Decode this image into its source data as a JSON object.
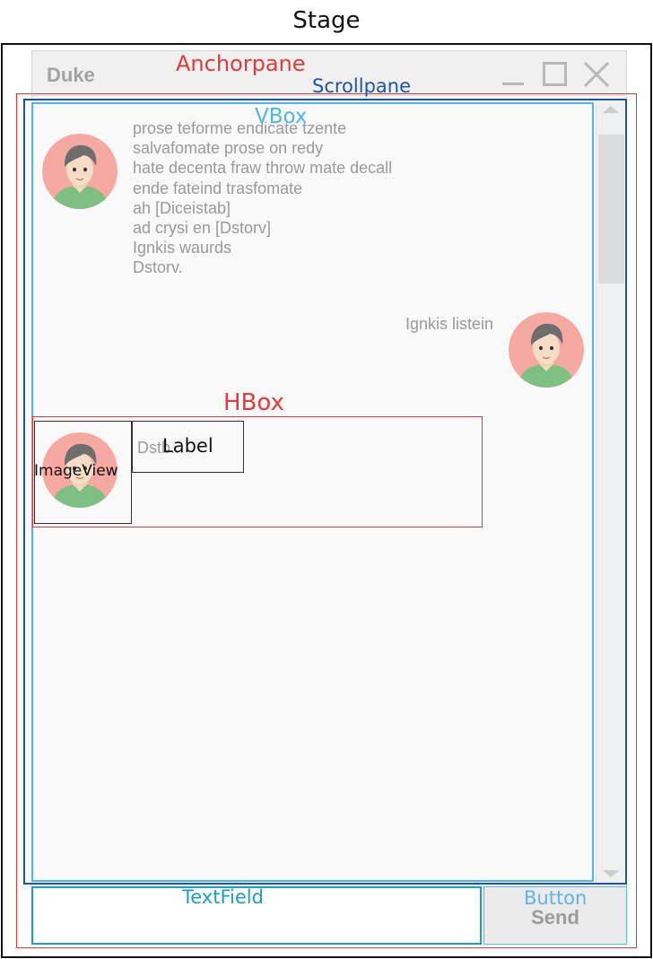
{
  "diagram": {
    "stage_label": "Stage",
    "anchorpane_label": "Anchorpane",
    "scrollpane_label": "Scrollpane",
    "vbox_label": "VBox",
    "hbox_label": "HBox",
    "imageview_label": "ImageView",
    "label_label": "Label",
    "textfield_label": "TextField",
    "button_label": "Button"
  },
  "window": {
    "title": "Duke",
    "send_button": "Send",
    "icons": [
      "minimize-icon",
      "maximize-icon",
      "close-icon",
      "avatar-icon"
    ]
  },
  "messages": [
    {
      "sender": "duke",
      "lines": [
        "prose teforme endicate tzente",
        "salvafomate prose on redy",
        "hate decenta fraw throw mate decall",
        "ende fateind trasfomate",
        "ah [Diceistab]",
        "ad crysi en [Dstorv]",
        "Ignkis waurds",
        "Dstorv."
      ]
    },
    {
      "sender": "user",
      "lines": [
        "Ignkis listein"
      ]
    },
    {
      "sender": "duke",
      "lines": [
        "Dstb..."
      ]
    }
  ],
  "colors": {
    "stage": "#111111",
    "anchorpane": "#e8393a",
    "scrollpane": "#1b55a8",
    "vbox": "#4cb6ee",
    "hbox": "#e8393a",
    "textfield": "#1a9fc0",
    "button": "#5fb4ea",
    "avatar_bg": "#f6a9a0"
  }
}
